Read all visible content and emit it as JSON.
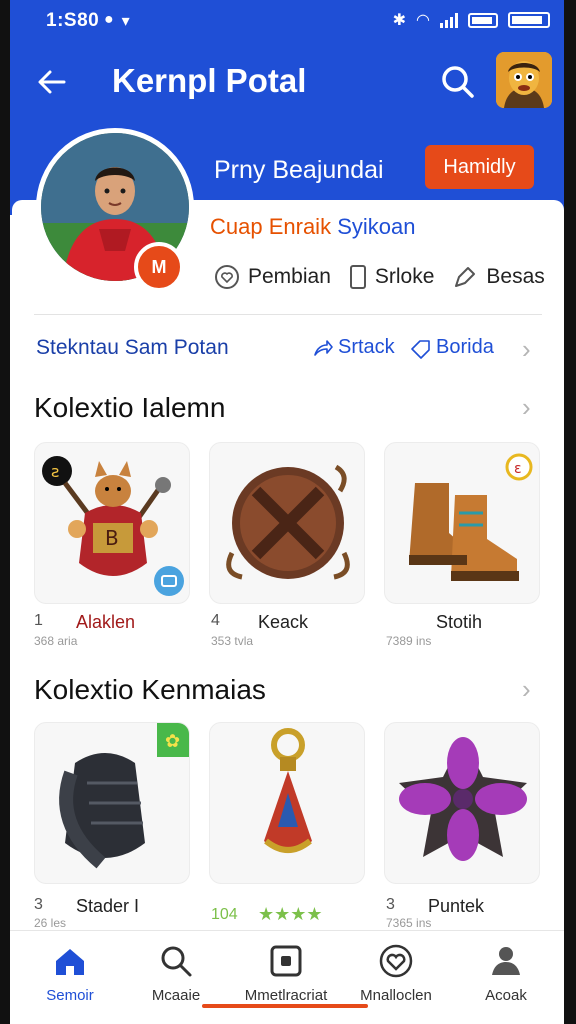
{
  "status_bar": {
    "time": "1:S80"
  },
  "app_bar": {
    "title": "Kernpl Potal"
  },
  "profile": {
    "name": "Prny Beajundai",
    "follow_label": "Hamidly",
    "badge": "M",
    "sub_a": "Cuap Enraik",
    "sub_b": "Syikoan",
    "stats": [
      "Pembian",
      "Srloke",
      "Besas"
    ]
  },
  "link_row": {
    "title": "Stekntau Sam Potan",
    "action_1": "Srtack",
    "action_2": "Borida"
  },
  "section_1": {
    "title": "Kolextio Ialemn",
    "items": [
      {
        "num": "1",
        "name": "Alaklen",
        "sub": "368 aria"
      },
      {
        "num": "4",
        "name": "Keack",
        "sub": "353 tvla"
      },
      {
        "num": "",
        "name": "Stotih",
        "sub": "7389 ins"
      }
    ]
  },
  "section_2": {
    "title": "Kolextio Kenmaias",
    "items": [
      {
        "num": "3",
        "name": "Stader I",
        "sub": "26 les"
      },
      {
        "num": "104",
        "name": "",
        "sub": "",
        "rating": "★★★★"
      },
      {
        "num": "3",
        "name": "Puntek",
        "sub": "7365 ins"
      }
    ]
  },
  "tabs": [
    {
      "label": "Semoir",
      "icon": "home-icon",
      "active": true
    },
    {
      "label": "Mcaaie",
      "icon": "search-icon",
      "active": false
    },
    {
      "label": "Mmetlracriat",
      "icon": "square-icon",
      "active": false
    },
    {
      "label": "Mnalloclen",
      "icon": "heart-icon",
      "active": false
    },
    {
      "label": "Acoak",
      "icon": "person-icon",
      "active": false
    }
  ],
  "colors": {
    "brand_blue": "#1f4fd6",
    "accent_orange": "#e64a19"
  }
}
